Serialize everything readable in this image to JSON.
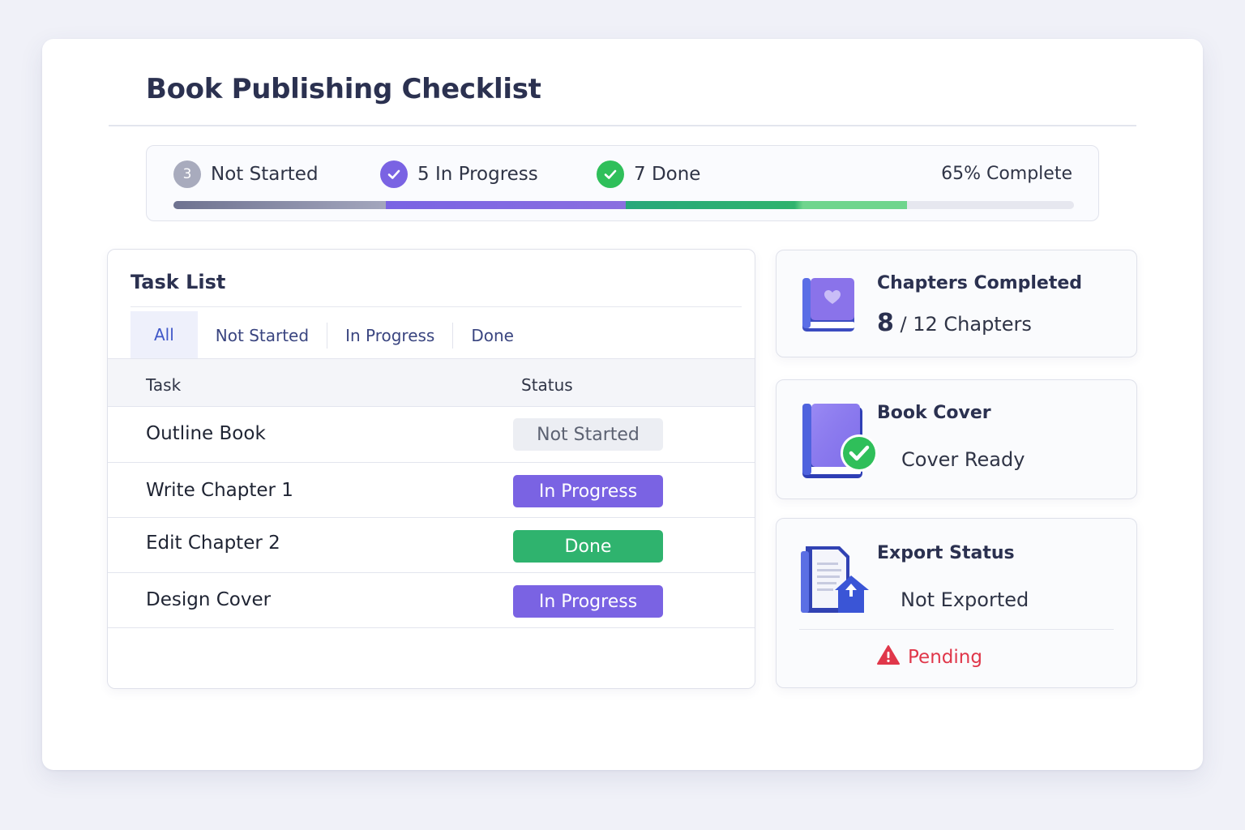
{
  "page": {
    "title": "Book Publishing Checklist"
  },
  "summary": {
    "not_started_count": "3",
    "not_started_label": "Not Started",
    "in_progress_label": "5 In Progress",
    "done_label": "7 Done",
    "percent_label": "65% Complete",
    "percent_complete": 65,
    "icons": {
      "in_progress": "check-circle-icon",
      "done": "check-circle-icon"
    },
    "colors": {
      "not_started": "#8a8fa6",
      "in_progress": "#7a63e3",
      "done": "#2fb36e"
    }
  },
  "task_panel": {
    "title": "Task List",
    "tabs": [
      {
        "label": "All",
        "active": true
      },
      {
        "label": "Not Started",
        "active": false
      },
      {
        "label": "In Progress",
        "active": false
      },
      {
        "label": "Done",
        "active": false
      }
    ],
    "columns": {
      "task": "Task",
      "status": "Status"
    },
    "rows": [
      {
        "task": "Outline Book",
        "status": "Not Started"
      },
      {
        "task": "Write Chapter 1",
        "status": "In Progress"
      },
      {
        "task": "Edit Chapter 2",
        "status": "Done"
      },
      {
        "task": "Design Cover",
        "status": "In Progress"
      }
    ]
  },
  "chapters_card": {
    "title": "Chapters Completed",
    "completed": "8",
    "rest": "/ 12 Chapters",
    "icon": "book-heart-icon"
  },
  "cover_card": {
    "title": "Book Cover",
    "value": "Cover Ready",
    "icon": "book-check-icon"
  },
  "export_card": {
    "title": "Export Status",
    "value": "Not Exported",
    "status": "Pending",
    "icon": "document-upload-icon",
    "status_icon": "warning-triangle-icon",
    "status_color": "#e0374a"
  }
}
